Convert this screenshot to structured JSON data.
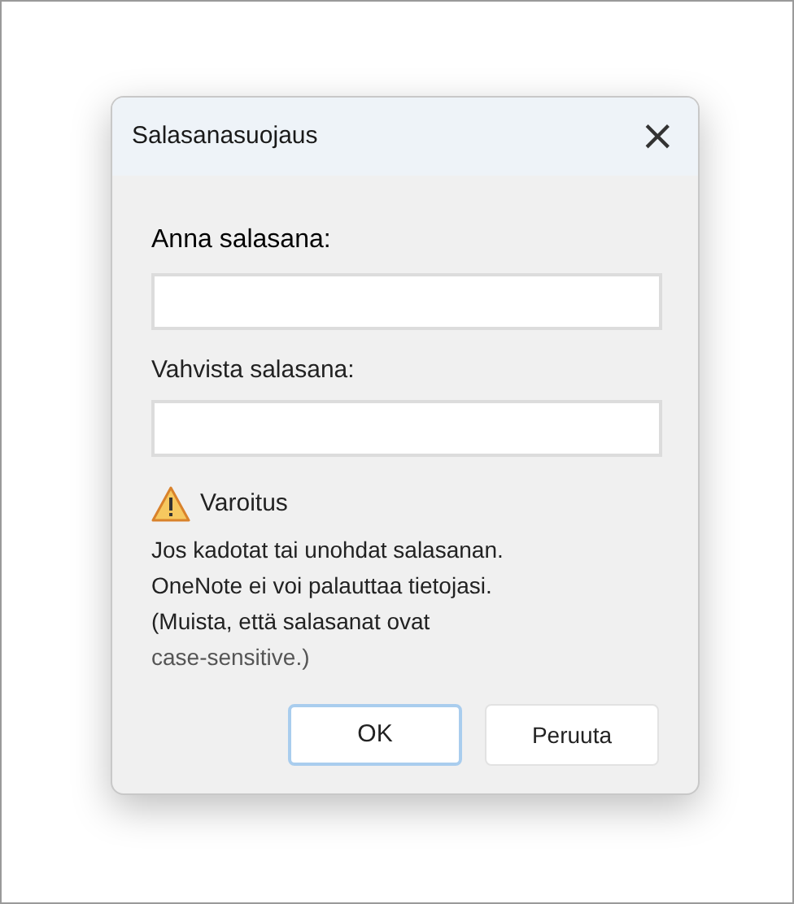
{
  "dialog": {
    "title": "Salasanasuojaus",
    "close": "×"
  },
  "fields": [
    {
      "label": "Anna salasana:"
    },
    {
      "label": "Vahvista salasana:"
    }
  ],
  "warning": {
    "title": "Varoitus",
    "lines": [
      "Jos kadotat tai unohdat salasanan.",
      "OneNote ei voi palauttaa tietojasi.",
      "(Muista, että salasanat ovat",
      "case-sensitive.)"
    ]
  },
  "buttons": [
    {
      "label": "OK",
      "default": true
    },
    {
      "label": "Peruuta",
      "default": false
    }
  ]
}
